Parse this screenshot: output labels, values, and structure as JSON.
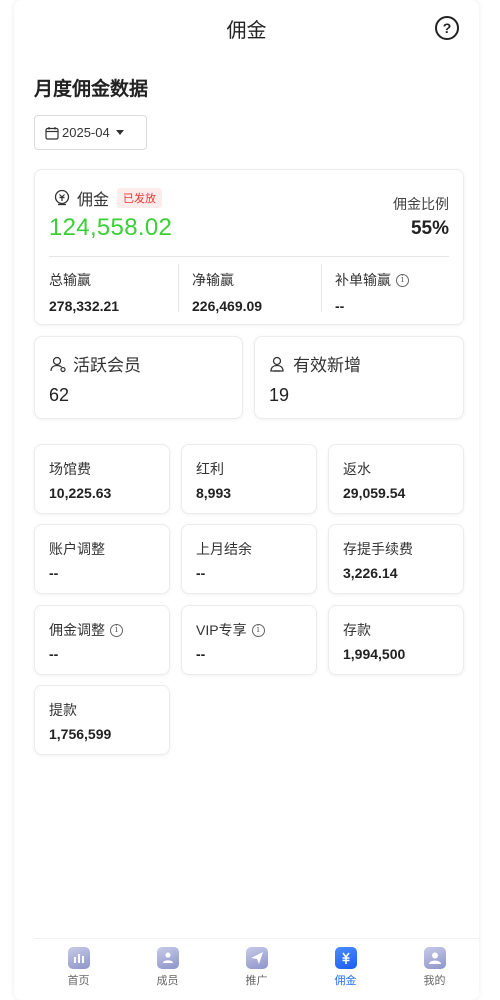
{
  "header": {
    "title": "佣金",
    "help_icon": "help-circle-icon"
  },
  "section_title": "月度佣金数据",
  "date_picker": {
    "value": "2025-04"
  },
  "commission": {
    "label": "佣金",
    "status_badge": "已发放",
    "value": "124,558.02",
    "ratio_label": "佣金比例",
    "ratio_value": "55%",
    "sub": [
      {
        "label": "总输赢",
        "value": "278,332.21"
      },
      {
        "label": "净输赢",
        "value": "226,469.09"
      },
      {
        "label": "补单输赢",
        "value": "--"
      }
    ]
  },
  "stats": [
    {
      "label": "活跃会员",
      "value": "62"
    },
    {
      "label": "有效新增",
      "value": "19"
    }
  ],
  "tiles": [
    {
      "label": "场馆费",
      "value": "10,225.63"
    },
    {
      "label": "红利",
      "value": "8,993"
    },
    {
      "label": "返水",
      "value": "29,059.54"
    },
    {
      "label": "账户调整",
      "value": "--"
    },
    {
      "label": "上月结余",
      "value": "--"
    },
    {
      "label": "存提手续费",
      "value": "3,226.14"
    },
    {
      "label": "佣金调整",
      "value": "--"
    },
    {
      "label": "VIP专享",
      "value": "--"
    },
    {
      "label": "存款",
      "value": "1,994,500"
    },
    {
      "label": "提款",
      "value": "1,756,599"
    }
  ],
  "colors": {
    "commission_value": "#3ccf3a",
    "badge": "#e53935",
    "active_tab": "#2b6bff"
  },
  "tabbar": [
    {
      "label": "首页",
      "icon": "home-icon"
    },
    {
      "label": "成员",
      "icon": "members-icon"
    },
    {
      "label": "推广",
      "icon": "promote-icon"
    },
    {
      "label": "佣金",
      "icon": "commission-icon",
      "active": true
    },
    {
      "label": "我的",
      "icon": "profile-icon"
    }
  ]
}
